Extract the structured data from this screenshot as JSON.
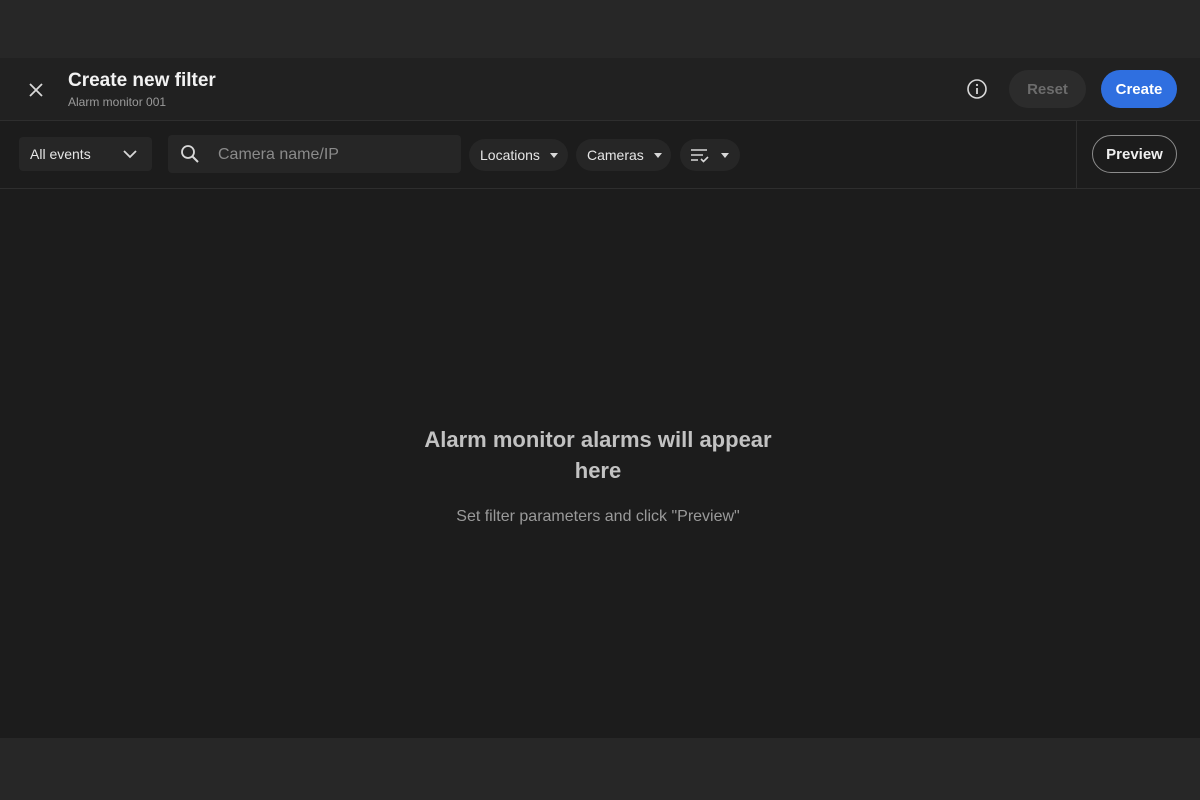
{
  "header": {
    "title": "Create new filter",
    "subtitle": "Alarm monitor 001",
    "reset_label": "Reset",
    "create_label": "Create",
    "close_icon": "close-icon",
    "info_icon": "info-icon"
  },
  "toolbar": {
    "events_select": {
      "value": "All events",
      "icon": "chevron-down-icon"
    },
    "search": {
      "placeholder": "Camera name/IP",
      "value": "",
      "icon": "search-icon"
    },
    "chips": [
      {
        "label": "Locations"
      },
      {
        "label": "Cameras"
      },
      {
        "icon": "filter-list-icon"
      }
    ],
    "preview_label": "Preview"
  },
  "empty_state": {
    "title": "Alarm monitor alarms will appear here",
    "subtitle": "Set filter parameters and click \"Preview\""
  },
  "colors": {
    "accent": "#2f6fe0",
    "background": "#1c1c1c",
    "page": "#272727"
  }
}
